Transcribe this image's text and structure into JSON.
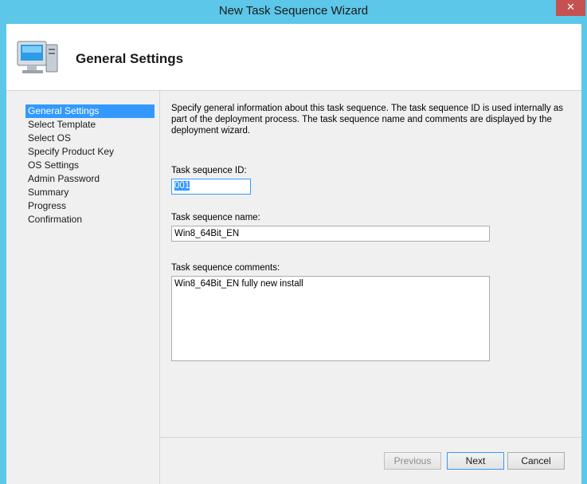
{
  "window": {
    "title": "New Task Sequence Wizard",
    "close_glyph": "✕"
  },
  "header": {
    "title": "General Settings",
    "icon": "computer-icon"
  },
  "nav": {
    "items": [
      {
        "label": "General Settings",
        "active": true
      },
      {
        "label": "Select Template"
      },
      {
        "label": "Select OS"
      },
      {
        "label": "Specify Product Key"
      },
      {
        "label": "OS Settings"
      },
      {
        "label": "Admin Password"
      },
      {
        "label": "Summary"
      },
      {
        "label": "Progress"
      },
      {
        "label": "Confirmation"
      }
    ]
  },
  "form": {
    "description": "Specify general information about this task sequence.  The task sequence ID is used internally as part of the deployment process.  The task sequence name and comments are displayed by the deployment wizard.",
    "id_label": "Task sequence ID:",
    "id_value": "001",
    "name_label": "Task sequence name:",
    "name_value": "Win8_64Bit_EN",
    "comments_label": "Task sequence comments:",
    "comments_value": "Win8_64Bit_EN fully new install"
  },
  "buttons": {
    "previous": "Previous",
    "next": "Next",
    "cancel": "Cancel"
  },
  "colors": {
    "titlebar": "#5cc7e8",
    "selection": "#3399ff",
    "close": "#c75050"
  }
}
